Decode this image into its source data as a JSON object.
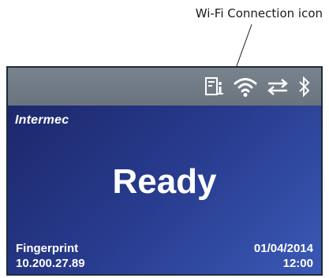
{
  "callout": {
    "label": "Wi-Fi Connection icon"
  },
  "status_bar": {
    "icons": [
      "printer-info-icon",
      "wifi-icon",
      "data-transfer-icon",
      "bluetooth-icon"
    ]
  },
  "screen": {
    "brand": "Intermec",
    "status_text": "Ready",
    "app_name": "Fingerprint",
    "ip_address": "10.200.27.89",
    "date": "01/04/2014",
    "time": "12:00"
  },
  "colors": {
    "screen_gradient_start": "#1b2565",
    "screen_gradient_end": "#3a59b5",
    "status_bar": "#78838d",
    "text": "#ffffff"
  }
}
